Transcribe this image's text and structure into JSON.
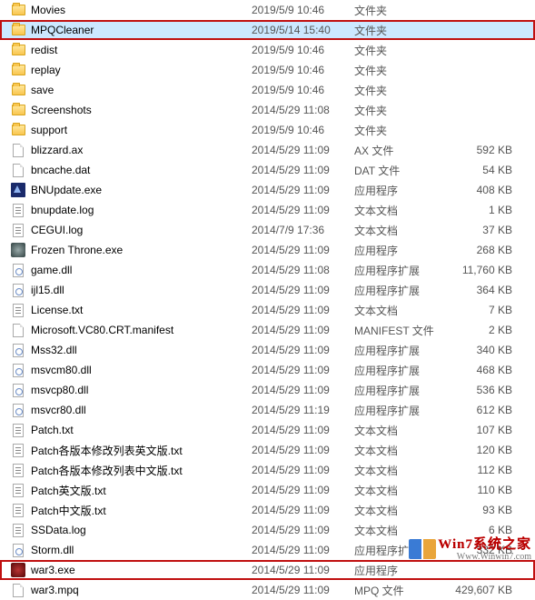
{
  "watermark": {
    "title": "Win7系统之家",
    "url": "Www.Winwin7.com"
  },
  "files": [
    {
      "icon": "folder",
      "name": "Movies",
      "date": "2019/5/9 10:46",
      "type": "文件夹",
      "size": ""
    },
    {
      "icon": "folder",
      "name": "MPQCleaner",
      "date": "2019/5/14 15:40",
      "type": "文件夹",
      "size": "",
      "selected": true,
      "highlighted": true
    },
    {
      "icon": "folder",
      "name": "redist",
      "date": "2019/5/9 10:46",
      "type": "文件夹",
      "size": ""
    },
    {
      "icon": "folder",
      "name": "replay",
      "date": "2019/5/9 10:46",
      "type": "文件夹",
      "size": ""
    },
    {
      "icon": "folder",
      "name": "save",
      "date": "2019/5/9 10:46",
      "type": "文件夹",
      "size": ""
    },
    {
      "icon": "folder",
      "name": "Screenshots",
      "date": "2014/5/29 11:08",
      "type": "文件夹",
      "size": ""
    },
    {
      "icon": "folder",
      "name": "support",
      "date": "2019/5/9 10:46",
      "type": "文件夹",
      "size": ""
    },
    {
      "icon": "file",
      "name": "blizzard.ax",
      "date": "2014/5/29 11:09",
      "type": "AX 文件",
      "size": "592 KB"
    },
    {
      "icon": "file",
      "name": "bncache.dat",
      "date": "2014/5/29 11:09",
      "type": "DAT 文件",
      "size": "54 KB"
    },
    {
      "icon": "bnu",
      "name": "BNUpdate.exe",
      "date": "2014/5/29 11:09",
      "type": "应用程序",
      "size": "408 KB"
    },
    {
      "icon": "txt",
      "name": "bnupdate.log",
      "date": "2014/5/29 11:09",
      "type": "文本文档",
      "size": "1 KB"
    },
    {
      "icon": "txt",
      "name": "CEGUI.log",
      "date": "2014/7/9 17:36",
      "type": "文本文档",
      "size": "37 KB"
    },
    {
      "icon": "ft",
      "name": "Frozen Throne.exe",
      "date": "2014/5/29 11:09",
      "type": "应用程序",
      "size": "268 KB"
    },
    {
      "icon": "dll",
      "name": "game.dll",
      "date": "2014/5/29 11:08",
      "type": "应用程序扩展",
      "size": "11,760 KB"
    },
    {
      "icon": "dll",
      "name": "ijl15.dll",
      "date": "2014/5/29 11:09",
      "type": "应用程序扩展",
      "size": "364 KB"
    },
    {
      "icon": "txt",
      "name": "License.txt",
      "date": "2014/5/29 11:09",
      "type": "文本文档",
      "size": "7 KB"
    },
    {
      "icon": "file",
      "name": "Microsoft.VC80.CRT.manifest",
      "date": "2014/5/29 11:09",
      "type": "MANIFEST 文件",
      "size": "2 KB"
    },
    {
      "icon": "dll",
      "name": "Mss32.dll",
      "date": "2014/5/29 11:09",
      "type": "应用程序扩展",
      "size": "340 KB"
    },
    {
      "icon": "dll",
      "name": "msvcm80.dll",
      "date": "2014/5/29 11:09",
      "type": "应用程序扩展",
      "size": "468 KB"
    },
    {
      "icon": "dll",
      "name": "msvcp80.dll",
      "date": "2014/5/29 11:09",
      "type": "应用程序扩展",
      "size": "536 KB"
    },
    {
      "icon": "dll",
      "name": "msvcr80.dll",
      "date": "2014/5/29 11:19",
      "type": "应用程序扩展",
      "size": "612 KB"
    },
    {
      "icon": "txt",
      "name": "Patch.txt",
      "date": "2014/5/29 11:09",
      "type": "文本文档",
      "size": "107 KB"
    },
    {
      "icon": "txt",
      "name": "Patch各版本修改列表英文版.txt",
      "date": "2014/5/29 11:09",
      "type": "文本文档",
      "size": "120 KB"
    },
    {
      "icon": "txt",
      "name": "Patch各版本修改列表中文版.txt",
      "date": "2014/5/29 11:09",
      "type": "文本文档",
      "size": "112 KB"
    },
    {
      "icon": "txt",
      "name": "Patch英文版.txt",
      "date": "2014/5/29 11:09",
      "type": "文本文档",
      "size": "110 KB"
    },
    {
      "icon": "txt",
      "name": "Patch中文版.txt",
      "date": "2014/5/29 11:09",
      "type": "文本文档",
      "size": "93 KB"
    },
    {
      "icon": "txt",
      "name": "SSData.log",
      "date": "2014/5/29 11:09",
      "type": "文本文档",
      "size": "6 KB"
    },
    {
      "icon": "dll",
      "name": "Storm.dll",
      "date": "2014/5/29 11:09",
      "type": "应用程序扩展",
      "size": "332 KB"
    },
    {
      "icon": "w3",
      "name": "war3.exe",
      "date": "2014/5/29 11:09",
      "type": "应用程序",
      "size": "",
      "highlighted": true
    },
    {
      "icon": "file",
      "name": "war3.mpq",
      "date": "2014/5/29 11:09",
      "type": "MPQ 文件",
      "size": "429,607 KB"
    }
  ]
}
